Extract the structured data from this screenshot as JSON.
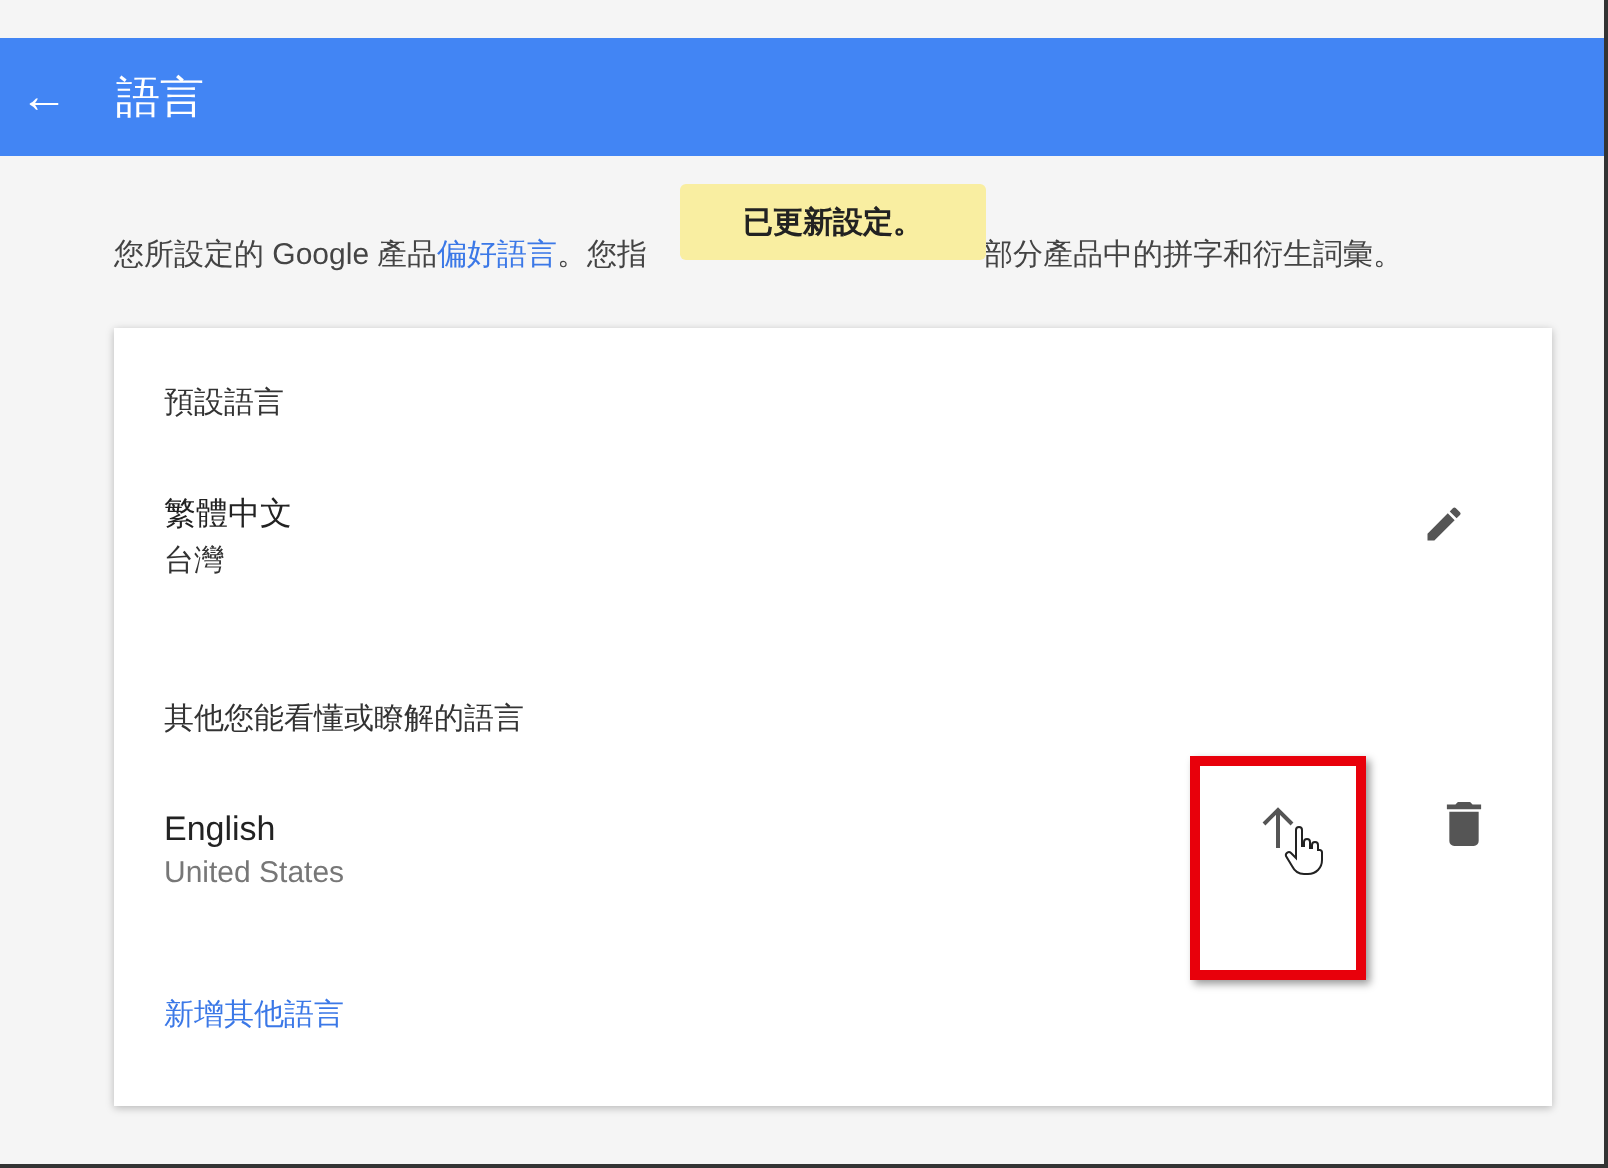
{
  "header": {
    "back_icon": "←",
    "title": "語言"
  },
  "toast": {
    "text": "已更新設定。"
  },
  "intro": {
    "before": "您所設定的 Google 產品",
    "link": "偏好語言",
    "after_link": "。您指",
    "after_toast": "部分產品中的拼字和衍生詞彙。"
  },
  "card": {
    "default_section": {
      "heading": "預設語言",
      "language": {
        "name": "繁體中文",
        "region": "台灣"
      }
    },
    "other_section": {
      "heading": "其他您能看懂或瞭解的語言",
      "languages": [
        {
          "name": "English",
          "region": "United States",
          "highlighted": true
        }
      ]
    },
    "add_link": "新增其他語言"
  }
}
